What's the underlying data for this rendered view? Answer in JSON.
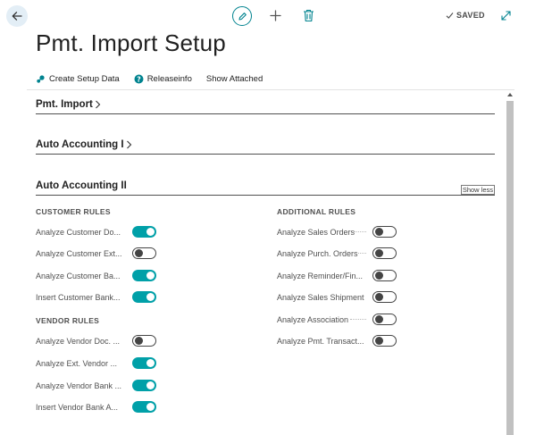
{
  "header": {
    "saved_label": "SAVED",
    "icons": [
      "back-arrow-icon",
      "edit-pencil-icon",
      "plus-icon",
      "trash-icon",
      "checkmark-icon",
      "expand-icon"
    ]
  },
  "page": {
    "title": "Pmt. Import Setup"
  },
  "actions": [
    {
      "label": "Create Setup Data",
      "icon": "setup-icon"
    },
    {
      "label": "Releaseinfo",
      "icon": "help-circle-icon"
    },
    {
      "label": "Show Attached",
      "icon": ""
    }
  ],
  "fasttabs": {
    "pmt_import": {
      "title": "Pmt. Import"
    },
    "auto_accounting_1": {
      "title": "Auto Accounting I"
    },
    "auto_accounting_2": {
      "title": "Auto Accounting II",
      "show_less": "Show less"
    }
  },
  "customer_rules": {
    "title": "CUSTOMER RULES",
    "items": [
      {
        "label": "Analyze Customer Do...",
        "on": true
      },
      {
        "label": "Analyze Customer Ext...",
        "on": false
      },
      {
        "label": "Analyze Customer Ba...",
        "on": true
      },
      {
        "label": "Insert Customer Bank...",
        "on": true
      }
    ]
  },
  "vendor_rules": {
    "title": "VENDOR RULES",
    "items": [
      {
        "label": "Analyze Vendor Doc. ...",
        "on": false
      },
      {
        "label": "Analyze Ext. Vendor ...",
        "on": true
      },
      {
        "label": "Analyze Vendor Bank ...",
        "on": true
      },
      {
        "label": "Insert Vendor Bank A...",
        "on": true
      }
    ]
  },
  "additional_rules": {
    "title": "ADDITIONAL RULES",
    "items": [
      {
        "label": "Analyze Sales Orders",
        "on": false
      },
      {
        "label": "Analyze Purch. Orders",
        "on": false
      },
      {
        "label": "Analyze Reminder/Fin...",
        "on": false
      },
      {
        "label": "Analyze Sales Shipment",
        "on": false
      },
      {
        "label": "Analyze Association",
        "on": false
      },
      {
        "label": "Analyze Pmt. Transact...",
        "on": false
      }
    ]
  },
  "colors": {
    "accent": "#00a0a8",
    "edit_ring": "#00838f",
    "back_bg": "#e3eef6"
  }
}
